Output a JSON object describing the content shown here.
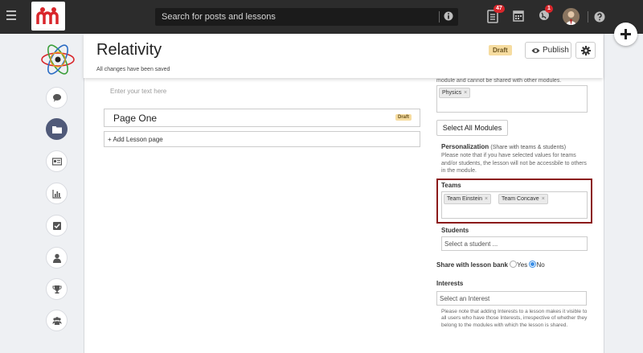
{
  "topbar": {
    "search_placeholder": "Search for posts and lessons",
    "notifications_count": "47",
    "messages_count": "1"
  },
  "header": {
    "title": "Relativity",
    "saved_status": "All changes have been saved",
    "draft_label": "Draft",
    "publish_label": "Publish"
  },
  "lesson": {
    "text_placeholder": "Enter your text here",
    "pages": [
      {
        "title": "Page One",
        "status": "Draft"
      }
    ],
    "add_page_label": "+ Add Lesson page"
  },
  "settings": {
    "modules_note": "module and cannot be shared with other modules.",
    "modules": [
      "Physics"
    ],
    "select_all_label": "Select All Modules",
    "personalization_title": "Personalization",
    "personalization_sub": "(Share with teams & students)",
    "personalization_note": "Please note that if you have selected values for teams and/or students, the lesson will not be accessbile to others in the module.",
    "teams_label": "Teams",
    "teams": [
      "Team Einstein",
      "Team Concave"
    ],
    "students_label": "Students",
    "students_placeholder": "Select a student ...",
    "share_label": "Share with lesson bank",
    "share_yes": "Yes",
    "share_no": "No",
    "share_selected": "No",
    "interests_label": "Interests",
    "interests_placeholder": "Select an Interest",
    "interests_note": "Please note that adding Interests to a lesson makes it visible to all users who have those Interests, irrespective of whether they belong to the modules with which the lesson is shared."
  },
  "sidebar": {
    "items": [
      "chat-icon",
      "folder-icon",
      "newspaper-icon",
      "bar-chart-icon",
      "checkbox-icon",
      "user-icon",
      "trophy-icon",
      "group-icon"
    ],
    "active_index": 1
  },
  "colors": {
    "topbar": "#2c2c2c",
    "sidebar_active": "#505a79",
    "draft_badge": "#f6dca0",
    "highlight_frame": "#8b1a1a",
    "notification_badge": "#d9262b",
    "radio_on": "#3a8ee6"
  }
}
